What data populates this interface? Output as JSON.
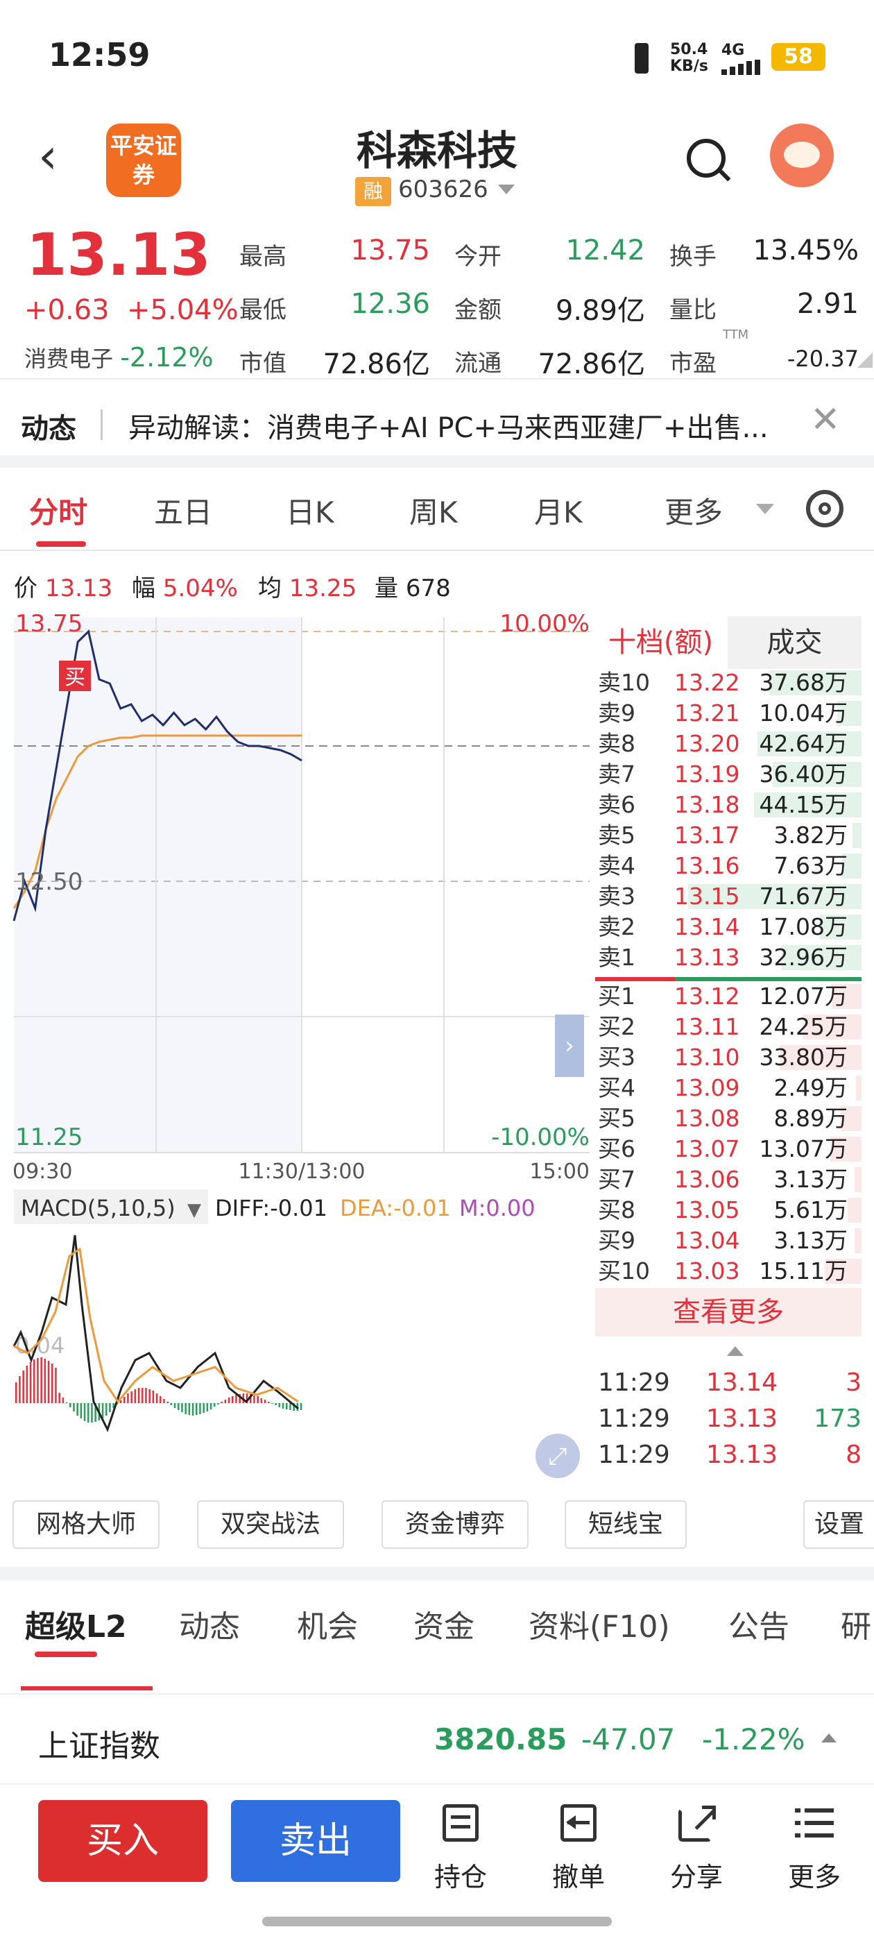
{
  "status": {
    "time": "12:59",
    "net_speed": "50.4",
    "net_unit": "KB/s",
    "network": "4G",
    "battery": "58"
  },
  "header": {
    "back": "‹",
    "broker": "平安证券",
    "stock_name": "科森科技",
    "margin_tag": "融",
    "code": "603626"
  },
  "quote": {
    "price": "13.13",
    "change": "+0.63",
    "change_pct": "+5.04%",
    "sector_name": "消费电子",
    "sector_pct": "-2.12%",
    "stats": [
      {
        "label": "最高",
        "value": "13.75",
        "color": "#e2313b"
      },
      {
        "label": "今开",
        "value": "12.42",
        "color": "#2a9d5c"
      },
      {
        "label": "换手",
        "value": "13.45%",
        "color": "#222222"
      },
      {
        "label": "最低",
        "value": "12.36",
        "color": "#2a9d5c"
      },
      {
        "label": "金额",
        "value": "9.89亿",
        "color": "#222222"
      },
      {
        "label": "量比",
        "value": "2.91",
        "color": "#222222"
      },
      {
        "label": "市值",
        "value": "72.86亿",
        "color": "#222222"
      },
      {
        "label": "流通",
        "value": "72.86亿",
        "color": "#222222"
      },
      {
        "label": "市盈",
        "value": "-20.37",
        "color": "#222222"
      }
    ],
    "ttm": "TTM"
  },
  "news": {
    "tag": "动态",
    "text": "异动解读：消费电子+AI PC+马来西亚建厂+出售...",
    "close": "✕"
  },
  "chart_tabs": [
    "分时",
    "五日",
    "日K",
    "周K",
    "月K",
    "更多"
  ],
  "info": {
    "price_label": "价",
    "price": "13.13",
    "pct_label": "幅",
    "pct": "5.04%",
    "avg_label": "均",
    "avg": "13.25",
    "vol_label": "量",
    "vol": "678"
  },
  "chart": {
    "max": "13.75",
    "max_pct": "10.00%",
    "mid": "12.50",
    "min": "11.25",
    "min_pct": "-10.00%",
    "buy_marker": "买",
    "t_start": "09:30",
    "t_mid": "11:30/13:00",
    "t_end": "15:00",
    "macd_label": "MACD(5,10,5)",
    "diff": "DIFF:-0.01",
    "dea": "DEA:-0.01",
    "m": "M:0.00",
    "macd_axis": "0.04"
  },
  "chart_data": {
    "type": "line",
    "title": "",
    "ylim": [
      11.25,
      13.75
    ],
    "series": [
      {
        "values": [
          12.36,
          12.55,
          12.42,
          12.8,
          13.1,
          13.4,
          13.7,
          13.75,
          13.52,
          13.5,
          13.38,
          13.4,
          13.32,
          13.35,
          13.3,
          13.36,
          13.3,
          13.33,
          13.28,
          13.34,
          13.27,
          13.22,
          13.2,
          13.2,
          13.19,
          13.18,
          13.16,
          13.13
        ]
      },
      {
        "values": [
          12.42,
          12.5,
          12.6,
          12.8,
          12.95,
          13.05,
          13.15,
          13.2,
          13.22,
          13.23,
          13.24,
          13.24,
          13.25,
          13.25,
          13.25,
          13.25,
          13.25,
          13.25,
          13.25,
          13.25,
          13.25,
          13.25,
          13.25,
          13.25,
          13.25,
          13.25,
          13.25,
          13.25
        ]
      }
    ]
  },
  "orderbook": {
    "tab1": "十档(额)",
    "tab2": "成交",
    "sells": [
      {
        "label": "卖10",
        "price": "13.22",
        "vol": "37.68万",
        "frac": 0.53
      },
      {
        "label": "卖9",
        "price": "13.21",
        "vol": "10.04万",
        "frac": 0.14
      },
      {
        "label": "卖8",
        "price": "13.20",
        "vol": "42.64万",
        "frac": 0.6
      },
      {
        "label": "卖7",
        "price": "13.19",
        "vol": "36.40万",
        "frac": 0.51
      },
      {
        "label": "卖6",
        "price": "13.18",
        "vol": "44.15万",
        "frac": 0.62
      },
      {
        "label": "卖5",
        "price": "13.17",
        "vol": "3.82万",
        "frac": 0.05
      },
      {
        "label": "卖4",
        "price": "13.16",
        "vol": "7.63万",
        "frac": 0.11
      },
      {
        "label": "卖3",
        "price": "13.15",
        "vol": "71.67万",
        "frac": 1.0
      },
      {
        "label": "卖2",
        "price": "13.14",
        "vol": "17.08万",
        "frac": 0.24
      },
      {
        "label": "卖1",
        "price": "13.13",
        "vol": "32.96万",
        "frac": 0.46
      }
    ],
    "buys": [
      {
        "label": "买1",
        "price": "13.12",
        "vol": "12.07万",
        "frac": 0.17
      },
      {
        "label": "买2",
        "price": "13.11",
        "vol": "24.25万",
        "frac": 0.34
      },
      {
        "label": "买3",
        "price": "13.10",
        "vol": "33.80万",
        "frac": 0.47
      },
      {
        "label": "买4",
        "price": "13.09",
        "vol": "2.49万",
        "frac": 0.03
      },
      {
        "label": "买5",
        "price": "13.08",
        "vol": "8.89万",
        "frac": 0.12
      },
      {
        "label": "买6",
        "price": "13.07",
        "vol": "13.07万",
        "frac": 0.18
      },
      {
        "label": "买7",
        "price": "13.06",
        "vol": "3.13万",
        "frac": 0.04
      },
      {
        "label": "买8",
        "price": "13.05",
        "vol": "5.61万",
        "frac": 0.08
      },
      {
        "label": "买9",
        "price": "13.04",
        "vol": "3.13万",
        "frac": 0.04
      },
      {
        "label": "买10",
        "price": "13.03",
        "vol": "15.11万",
        "frac": 0.21
      }
    ],
    "more": "查看更多",
    "ticks": [
      {
        "time": "11:29",
        "price": "13.14",
        "vol": "3",
        "vol_color": "#e2313b"
      },
      {
        "time": "11:29",
        "price": "13.13",
        "vol": "173",
        "vol_color": "#2a9d5c"
      },
      {
        "time": "11:29",
        "price": "13.13",
        "vol": "8",
        "vol_color": "#e2313b"
      }
    ]
  },
  "tools": [
    "网格大师",
    "双突战法",
    "资金博弈",
    "短线宝",
    "设置"
  ],
  "bottom_tabs": [
    "超级L2",
    "动态",
    "机会",
    "资金",
    "资料(F10)",
    "公告",
    "研"
  ],
  "index": {
    "name": "上证指数",
    "value": "3820.85",
    "change": "-47.07",
    "pct": "-1.22%"
  },
  "actions": {
    "buy": "买入",
    "sell": "卖出",
    "items": [
      {
        "label": "持仓",
        "icon": "holdings-icon"
      },
      {
        "label": "撤单",
        "icon": "cancel-order-icon"
      },
      {
        "label": "分享",
        "icon": "share-icon"
      },
      {
        "label": "更多",
        "icon": "menu-icon"
      }
    ]
  }
}
